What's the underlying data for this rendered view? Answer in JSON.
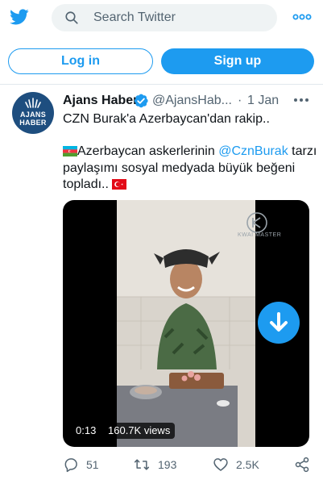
{
  "header": {
    "search_placeholder": "Search Twitter",
    "icons": [
      "twitter-bird-icon",
      "search-icon",
      "more-icon"
    ]
  },
  "auth": {
    "login_label": "Log in",
    "signup_label": "Sign up"
  },
  "tweet": {
    "author_name": "Ajans Haber",
    "handle": "@AjansHab...",
    "separator": "·",
    "date": "1 Jan",
    "avatar_line1": "AJANS",
    "avatar_line2": "HABER",
    "text_line1": "CZN Burak'a Azerbaycan'dan rakip..",
    "text_line2_pre": "Azerbaycan askerlerinin ",
    "text_line2_mention": "@CznBurak",
    "text_line2_post": " tarzı",
    "text_line3": "paylaşımı sosyal medyada büyük beğeni",
    "text_line4": "topladı..",
    "media": {
      "elapsed": "0:13",
      "views": "160.7K views",
      "watermark": "KWAI MASTER"
    },
    "actions": {
      "replies": "51",
      "retweets": "193",
      "likes": "2.5K"
    }
  },
  "colors": {
    "accent": "#1d9bf0",
    "text": "#0f1419",
    "muted": "#536471",
    "avatar_bg": "#1e4e7f"
  }
}
